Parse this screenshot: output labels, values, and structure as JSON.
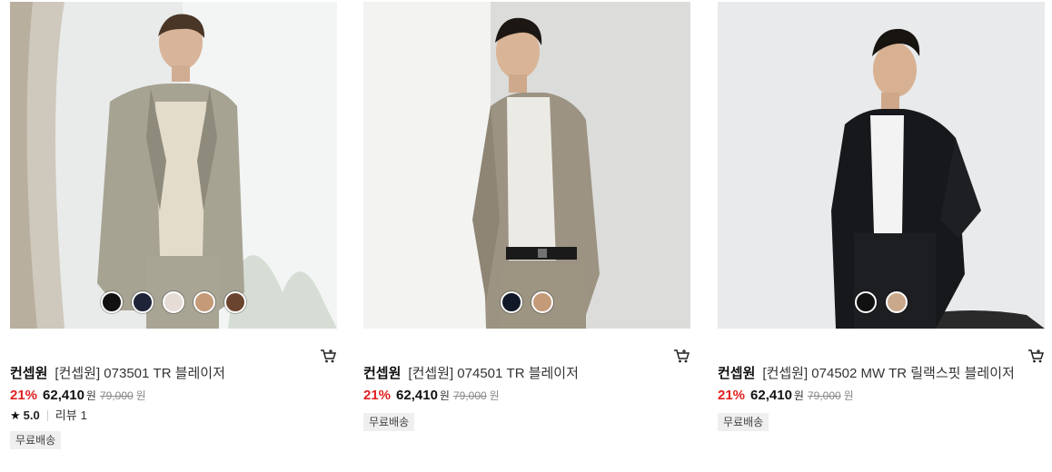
{
  "products": [
    {
      "brand": "컨셉원",
      "name": "[컨셉원] 073501 TR 블레이저",
      "discount": "21%",
      "price": "62,410",
      "currency": "원",
      "original_price": "79,000",
      "original_currency": "원",
      "rating": "5.0",
      "review_label": "리뷰",
      "review_count": "1",
      "badge": "무료배송",
      "swatches": [
        "#111111",
        "#1f2438",
        "#e6dcd6",
        "#c49a78",
        "#6b4430"
      ]
    },
    {
      "brand": "컨셉원",
      "name": "[컨셉원] 074501 TR 블레이저",
      "discount": "21%",
      "price": "62,410",
      "currency": "원",
      "original_price": "79,000",
      "original_currency": "원",
      "badge": "무료배송",
      "swatches": [
        "#111827",
        "#c49a78"
      ]
    },
    {
      "brand": "컨셉원",
      "name": "[컨셉원] 074502 MW TR 릴랙스핏 블레이저",
      "discount": "21%",
      "price": "62,410",
      "currency": "원",
      "original_price": "79,000",
      "original_currency": "원",
      "badge": "무료배송",
      "swatches": [
        "#111111",
        "#c9a88c"
      ]
    }
  ],
  "icons": {
    "cart": "cart-icon",
    "star": "star-icon"
  }
}
